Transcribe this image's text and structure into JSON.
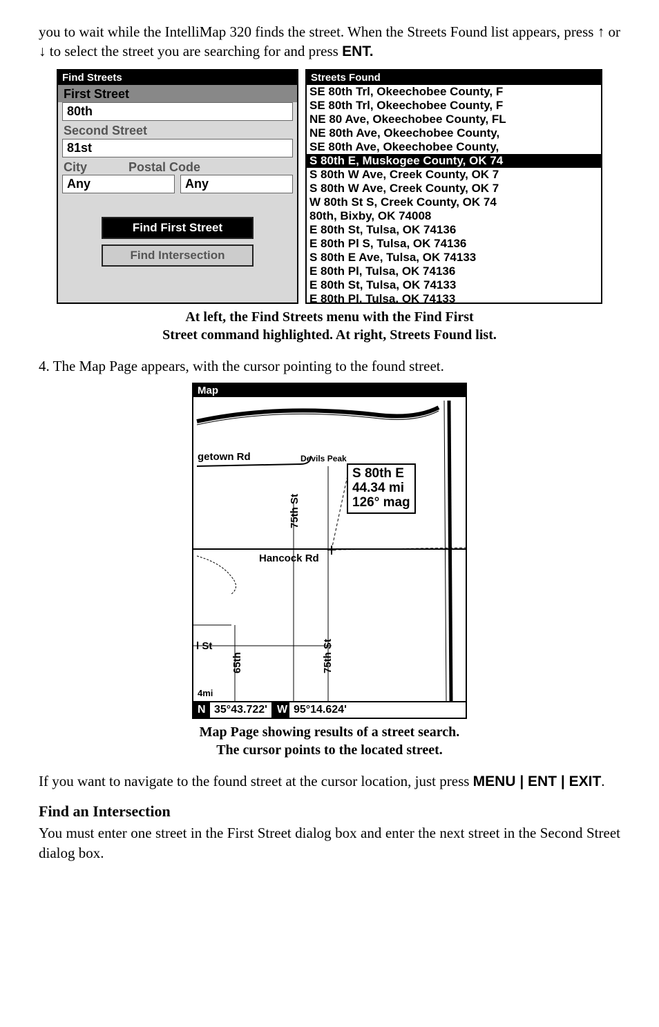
{
  "intro": {
    "p1a": "you to wait while the IntelliMap 320 finds the street. When the Streets Found list appears, press ",
    "arrows": "↑ or ↓",
    "p1b": " to select the street you are searching for and press ",
    "entword": "ENT."
  },
  "left": {
    "title": "Find Streets",
    "lbl_first": "First Street",
    "first_val": "80th",
    "lbl_second": "Second Street",
    "second_val": "81st",
    "lbl_city": "City",
    "lbl_postal": "Postal Code",
    "city_val": "Any",
    "postal_val": "Any",
    "btn_find": "Find First Street",
    "btn_inter": "Find Intersection"
  },
  "right": {
    "title": "Streets Found",
    "items": [
      "SE 80th Trl, Okeechobee County, F",
      "SE 80th Trl, Okeechobee County, F",
      "NE 80 Ave, Okeechobee County, FL",
      "NE 80th Ave, Okeechobee County,",
      "SE 80th Ave, Okeechobee County,"
    ],
    "highlight": "S 80th E, Muskogee County, OK 74",
    "items2": [
      "S 80th W Ave, Creek County, OK 7",
      "S 80th W Ave, Creek County, OK 7",
      "W 80th St S, Creek County, OK 74",
      "80th, Bixby, OK 74008",
      "E 80th St, Tulsa, OK 74136",
      "E 80th Pl S, Tulsa, OK 74136",
      "S 80th E Ave, Tulsa, OK 74133",
      "E 80th Pl, Tulsa, OK 74136",
      "E 80th St, Tulsa, OK 74133",
      "E 80th Pl, Tulsa, OK 74133"
    ]
  },
  "caption1a": "At left, the Find Streets menu with the Find First",
  "caption1b": "Street command highlighted. At right, Streets Found list.",
  "step4": "4. The Map Page appears, with the cursor pointing to the found street.",
  "map": {
    "title": "Map",
    "rd1": "getown Rd",
    "peak": "Devils Peak",
    "hwy1": "S 80th E",
    "hwy2": "44.34 mi",
    "hwy3": "126° mag",
    "rd2": "Hancock Rd",
    "lbl75": "75th St",
    "lbl75b": "75th St",
    "lbl65": "65th",
    "lblst": "l St",
    "scale": "4mi",
    "lat_dir": "N",
    "lat": "35°43.722'",
    "lon_dir": "W",
    "lon": "95°14.624'"
  },
  "caption2a": "Map Page showing results of a street search.",
  "caption2b": "The cursor points to the located street.",
  "nav": {
    "pa": "If you want to navigate to the found street at the cursor location, just press ",
    "keys": "MENU | ENT | EXIT",
    "pc": "."
  },
  "sub": "Find an Intersection",
  "last": "You must enter one street in the First Street dialog box and enter the next street in the Second Street dialog box."
}
